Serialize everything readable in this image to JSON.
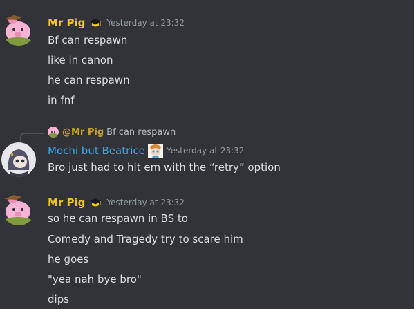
{
  "messages": [
    {
      "username": "Mr Pig",
      "username_color": "#f0c419",
      "role_icon": "graduation-cap-icon",
      "timestamp": "Yesterday at 23:32",
      "avatar_icon": "pig-avatar-icon",
      "lines": [
        "Bf can respawn",
        "like in canon",
        "he can respawn",
        "in fnf"
      ]
    },
    {
      "reply": {
        "mention": "@Mr Pig",
        "text": "Bf can respawn"
      },
      "username": "Mochi but Beatrice",
      "username_color": "#3ba3e0",
      "role_icon": "character-badge-icon",
      "timestamp": "Yesterday at 23:32",
      "avatar_icon": "hooded-character-avatar-icon",
      "lines": [
        "Bro just had to hit em with the “retry” option"
      ]
    },
    {
      "username": "Mr Pig",
      "username_color": "#f0c419",
      "role_icon": "graduation-cap-icon",
      "timestamp": "Yesterday at 23:32",
      "avatar_icon": "pig-avatar-icon",
      "lines": [
        "so he can respawn in BS to",
        "Comedy and Tragedy try to scare him",
        "he goes",
        "\"yea nah bye bro\"",
        "dips"
      ]
    }
  ]
}
